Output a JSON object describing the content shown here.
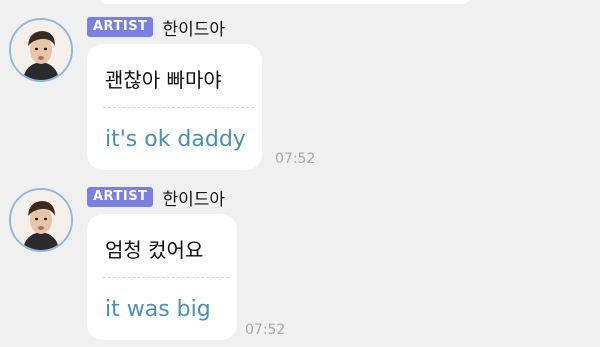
{
  "messages": [
    {
      "badge": "ARTIST",
      "sender": "한이드아",
      "original": "괜찮아 빠마야",
      "translation": "it's ok daddy",
      "time": "07:52"
    },
    {
      "badge": "ARTIST",
      "sender": "한이드아",
      "original": "엄청 컸어요",
      "translation": "it was big",
      "time": "07:52"
    }
  ],
  "colors": {
    "badge": "#7b7fe2",
    "translation_text": "#4a8fb8",
    "avatar_ring": "#8fb7e6",
    "background": "#f0f0f0"
  }
}
